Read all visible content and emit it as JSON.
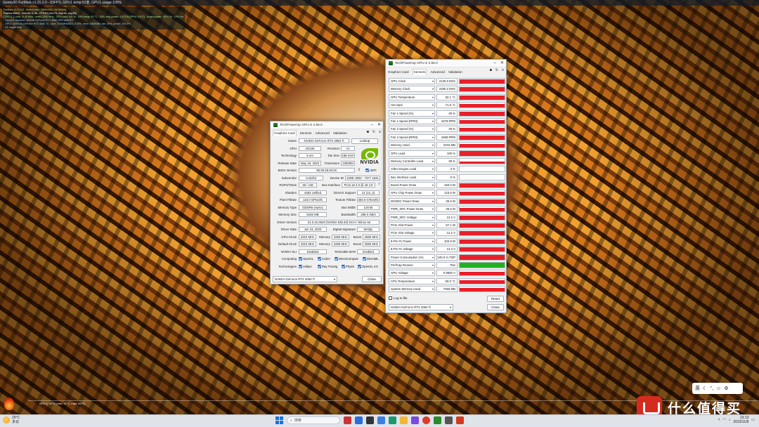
{
  "osd": {
    "title": "Geeks3D FurMark v1.31.0.0 - 83FPS, GPU1 temp:62度, GPU1 usage:100%",
    "lines": [
      "FurMark v1.31.0.0 - Burn-in test, 2560x1440 (0X MSAA)",
      "Frames:40843 - time:08:11:45 - FPS:83 (min:73, max:93, avg:83)",
      "[ GPU 1 ]: core: 2130 MHz - mem: 2250 MHz - GPU load: 100 % - GPU temp: 62 °C - GPU chip power: 123.5 W (PPW: 0.672) - Board power: 160.0 W - GPU voltage: 0.860 V",
      "- OpenGL renderer: NVIDIA GeForce RTX 4060 Ti/PCIe/SSE2",
      "- GPU 1 (NVIDIA GeForce RTX 4060 Ti) - core: 2130MHz/62°C/100%, mem: 9000MHz, fan: 49%, power: 100.0%",
      "- F1: toggle help"
    ],
    "bottom_text": "GPU 1: 62°C (min: 31°C, max: 62°C)"
  },
  "gpuz_graphics": {
    "title": "TechPowerUp GPU-Z 2.55.0",
    "tabs": [
      "Graphics Card",
      "Sensors",
      "Advanced",
      "Validation"
    ],
    "active_tab": "Graphics Card",
    "fields": {
      "name_label": "Name",
      "name": "NVIDIA GeForce RTX 4060 Ti",
      "lookup": "Lookup",
      "gpu_label": "GPU",
      "gpu": "AD106",
      "revision_label": "Revision",
      "revision": "A1",
      "technology_label": "Technology",
      "technology": "5 nm",
      "die_size_label": "Die Size",
      "die_size": "188 mm²",
      "release_date_label": "Release Date",
      "release_date": "May 18, 2023",
      "transistors_label": "Transistors",
      "transistors": "22900M",
      "bios_label": "BIOS Version",
      "bios": "95.06.28.00.6C",
      "uefi": "UEFI",
      "subvendor_label": "Subvendor",
      "subvendor": "Colorful",
      "device_id_label": "Device ID",
      "device_id": "10DE 2803 - 7377 1631",
      "rops_label": "ROPs/TMUs",
      "rops": "48 / 136",
      "bus_label": "Bus Interface",
      "bus": "PCIe x8 4.0 @ x8 4.0",
      "help": "?",
      "shaders_label": "Shaders",
      "shaders": "4352 Unified",
      "directx_label": "DirectX Support",
      "directx": "12 (12_2)",
      "pixel_label": "Pixel Fillrate",
      "pixel": "123.0 GPixel/s",
      "texture_label": "Texture Fillrate",
      "texture": "350.9 GTexel/s",
      "memtype_label": "Memory Type",
      "memtype": "GDDR6 (Hynix)",
      "buswidth_label": "Bus Width",
      "buswidth": "128 bit",
      "memsize_label": "Memory Size",
      "memsize": "8192 MB",
      "bandwidth_label": "Bandwidth",
      "bandwidth": "288.0 GB/s",
      "driver_label": "Driver Version",
      "driver": "31.0.15.3640 (NVIDIA 536.40) DCH / Win11 64",
      "driver_date_label": "Driver Date",
      "driver_date": "Jun 23, 2023",
      "dsig_label": "Digital Signature",
      "dsig": "WHQL",
      "gpu_clock_label": "GPU Clock",
      "gpu_clock": "2310 MHz",
      "memory_label": "Memory",
      "memory_clock": "2250 MHz",
      "boost_label": "Boost",
      "boost": "2560 MHz",
      "default_clock_label": "Default Clock",
      "default_clock": "2310 MHz",
      "default_memory": "2250 MHz",
      "default_boost": "2560 MHz",
      "sli_label": "NVIDIA SLI",
      "sli": "Disabled",
      "rebar_label": "Resizable BAR",
      "rebar": "Enabled",
      "computing_label": "Computing",
      "computing": [
        "OpenCL",
        "CUDA",
        "DirectCompute",
        "DirectML"
      ],
      "technologies_label": "Technologies",
      "technologies": [
        "Vulkan",
        "Ray Tracing",
        "PhysX",
        "OpenGL 4.6"
      ]
    },
    "gpu_select": "NVIDIA GeForce RTX 4060 Ti",
    "close": "Close"
  },
  "gpuz_sensors": {
    "title": "TechPowerUp GPU-Z 2.55.0",
    "tabs": [
      "Graphics Card",
      "Sensors",
      "Advanced",
      "Validation"
    ],
    "active_tab": "Sensors",
    "rows": [
      {
        "name": "GPU Clock",
        "value": "2130.0 MHz",
        "level": 0.85,
        "color": "#e8202a"
      },
      {
        "name": "Memory Clock",
        "value": "2250.2 MHz",
        "level": 0.85,
        "color": "#e8202a"
      },
      {
        "name": "GPU Temperature",
        "value": "62.1 °C",
        "level": 0.8,
        "color": "#e8202a"
      },
      {
        "name": "Hot Spot",
        "value": "71.6 °C",
        "level": 0.8,
        "color": "#e8202a"
      },
      {
        "name": "Fan 1 Speed (%)",
        "value": "49 %",
        "level": 0.75,
        "color": "#e8202a"
      },
      {
        "name": "Fan 1 Speed (RPM)",
        "value": "1578 RPM",
        "level": 0.75,
        "color": "#e8202a"
      },
      {
        "name": "Fan 2 Speed (%)",
        "value": "49 %",
        "level": 0.75,
        "color": "#e8202a"
      },
      {
        "name": "Fan 2 Speed (RPM)",
        "value": "1568 RPM",
        "level": 0.75,
        "color": "#e8202a"
      },
      {
        "name": "Memory Used",
        "value": "2332 MB",
        "level": 0.7,
        "color": "#e8202a"
      },
      {
        "name": "GPU Load",
        "value": "100 %",
        "level": 0.9,
        "color": "#e8202a"
      },
      {
        "name": "Memory Controller Load",
        "value": "38 %",
        "level": 0.45,
        "color": "#e8202a"
      },
      {
        "name": "Video Engine Load",
        "value": "3 %",
        "level": 0.08,
        "color": "#e8202a"
      },
      {
        "name": "Bus Interface Load",
        "value": "0 %",
        "level": 0.0,
        "color": "#e8202a"
      },
      {
        "name": "Board Power Draw",
        "value": "160.0 W",
        "level": 0.85,
        "color": "#e8202a"
      },
      {
        "name": "GPU Chip Power Draw",
        "value": "123.5 W",
        "level": 0.85,
        "color": "#e8202a"
      },
      {
        "name": "MVDDC Power Draw",
        "value": "36.6 W",
        "level": 0.8,
        "color": "#e8202a"
      },
      {
        "name": "PWR_SRC Power Draw",
        "value": "36.6 W",
        "level": 0.8,
        "color": "#e8202a"
      },
      {
        "name": "PWR_SRC Voltage",
        "value": "12.2 V",
        "level": 0.85,
        "color": "#e8202a"
      },
      {
        "name": "PCIe Slot Power",
        "value": "57.1 W",
        "level": 0.8,
        "color": "#e8202a"
      },
      {
        "name": "PCIe Slot Voltage",
        "value": "12.2 V",
        "level": 0.85,
        "color": "#e8202a"
      },
      {
        "name": "8-Pin #1 Power",
        "value": "102.9 W",
        "level": 0.85,
        "color": "#e8202a"
      },
      {
        "name": "8-Pin #1 Voltage",
        "value": "12.3 V",
        "level": 0.85,
        "color": "#e8202a"
      },
      {
        "name": "Power Consumption (%)",
        "value": "100.0 % TDP",
        "level": 0.9,
        "color": "#e8202a"
      },
      {
        "name": "PerfCap Reason",
        "value": "Pwr",
        "level": 1.0,
        "color": "#22b022"
      },
      {
        "name": "GPU Voltage",
        "value": "0.8600 V",
        "level": 0.8,
        "color": "#e8202a"
      },
      {
        "name": "CPU Temperature",
        "value": "50.0 °C",
        "level": 0.65,
        "color": "#e8202a"
      },
      {
        "name": "System Memory Used",
        "value": "7066 MB",
        "level": 0.7,
        "color": "#e8202a"
      }
    ],
    "log_to_file": "Log to file",
    "reset": "Reset",
    "gpu_select": "NVIDIA GeForce RTX 4060 Ti",
    "close": "Close"
  },
  "ime": {
    "lang": "英"
  },
  "watermark": {
    "text": "什么值得买"
  },
  "taskbar": {
    "weather_temp": "29°C",
    "weather_desc": "多云",
    "search_placeholder": "搜索",
    "time": "13:13",
    "date": "2023/11/8"
  }
}
